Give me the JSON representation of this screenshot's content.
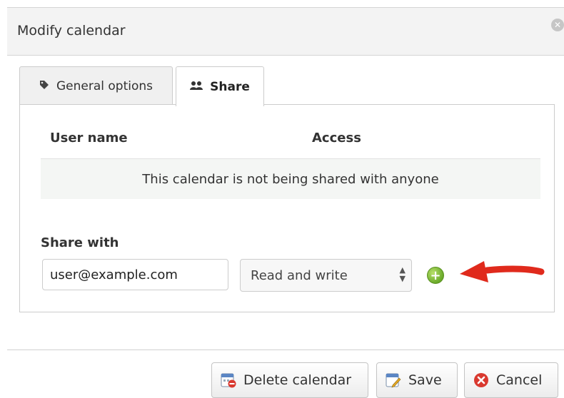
{
  "dialog": {
    "title": "Modify calendar",
    "close_icon": "close-icon"
  },
  "tabs": [
    {
      "label": "General options",
      "icon": "tag-icon",
      "active": false
    },
    {
      "label": "Share",
      "icon": "users-icon",
      "active": true
    }
  ],
  "share_table": {
    "columns": [
      "User name",
      "Access"
    ],
    "empty_message": "This calendar is not being shared with anyone"
  },
  "share_form": {
    "label": "Share with",
    "email_value": "user@example.com",
    "access_selected": "Read and write",
    "add_icon": "plus-circle-icon"
  },
  "buttons": {
    "delete_label": "Delete calendar",
    "save_label": "Save",
    "cancel_label": "Cancel"
  },
  "colors": {
    "add_button": "#6aaa2a",
    "annotation_arrow": "#e02a1c",
    "cancel_icon": "#d9392f"
  }
}
